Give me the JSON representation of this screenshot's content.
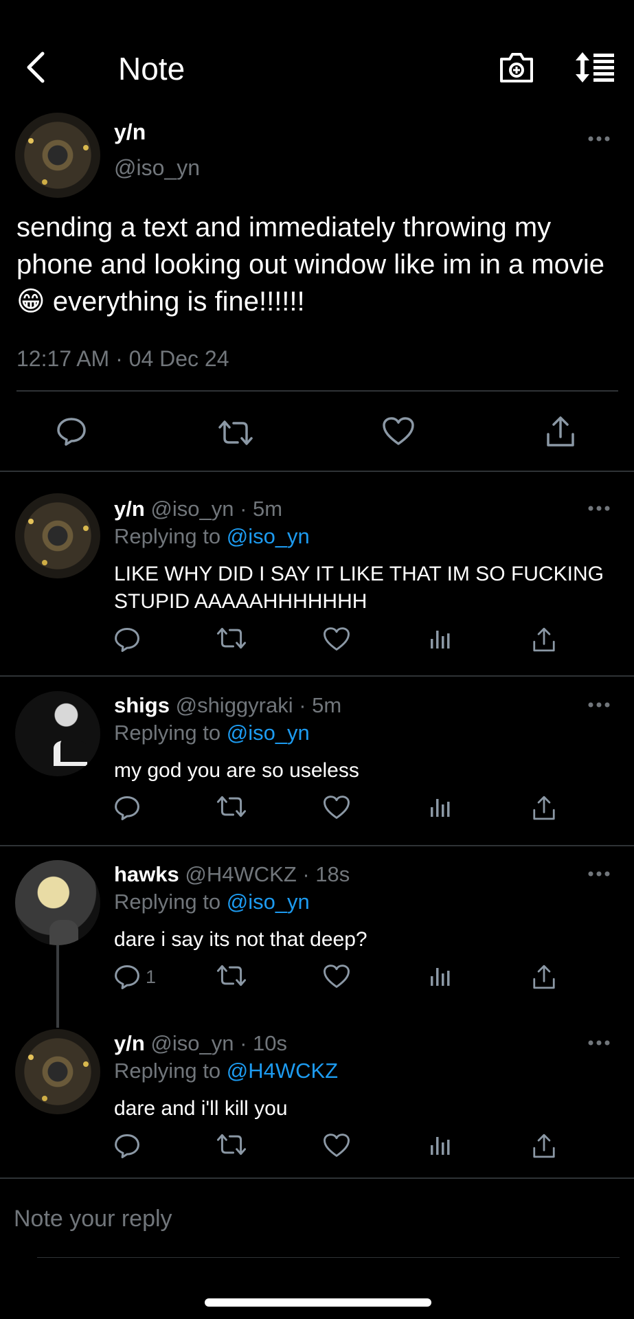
{
  "header": {
    "title": "Note",
    "back_icon": "chevron-left-icon",
    "camera_icon": "camera-add-icon",
    "sort_icon": "sort-list-icon"
  },
  "main_tweet": {
    "name": "y/n",
    "handle": "@iso_yn",
    "text": "sending a text and immediately throwing my phone and looking out window like im in a movie 😁 everything is fine!!!!!!",
    "time": "12:17 AM · 04 Dec 24"
  },
  "replies": [
    {
      "name": "y/n",
      "meta": "@iso_yn · 5m",
      "replying_prefix": "Replying to",
      "replying_to": "@iso_yn",
      "text": "LIKE WHY DID I SAY IT LIKE THAT IM SO FUCKING STUPID AAAAAHHHHHHH"
    },
    {
      "name": "shigs",
      "meta": "@shiggyraki · 5m",
      "replying_prefix": "Replying to",
      "replying_to": "@iso_yn",
      "text": "my god you are so useless"
    },
    {
      "name": "hawks",
      "meta": "@H4WCKZ · 18s",
      "replying_prefix": "Replying to",
      "replying_to": "@iso_yn",
      "text": "dare i say its not that deep?",
      "reply_count": "1"
    },
    {
      "name": "y/n",
      "meta": "@iso_yn · 10s",
      "replying_prefix": "Replying to",
      "replying_to": "@H4WCKZ",
      "text": "dare and i'll kill you"
    }
  ],
  "composer": {
    "placeholder": "Note your reply"
  },
  "colors": {
    "background": "#000000",
    "accent": "#1d9bf0",
    "secondary_text": "#71767b",
    "divider": "#2f3336"
  }
}
